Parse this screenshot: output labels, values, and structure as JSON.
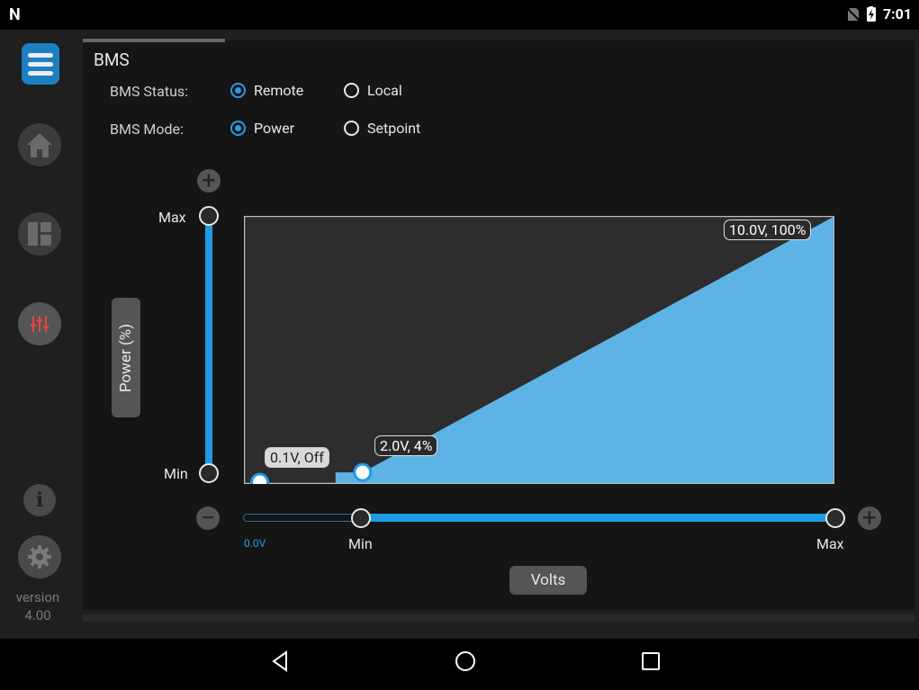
{
  "status": {
    "time": "7:01"
  },
  "sidebar": {
    "version_label": "version",
    "version_number": "4.00"
  },
  "panel": {
    "title": "BMS",
    "status_label": "BMS Status:",
    "status_options": [
      "Remote",
      "Local"
    ],
    "status_selected": "Remote",
    "mode_label": "BMS Mode:",
    "mode_options": [
      "Power",
      "Setpoint"
    ],
    "mode_selected": "Power"
  },
  "graph": {
    "y_axis_label": "Power (%)",
    "x_axis_label": "Volts",
    "y_max_label": "Max",
    "y_min_label": "Min",
    "x_min_label": "Min",
    "x_max_label": "Max",
    "x_start_value": "0.0V",
    "points": [
      {
        "label": "0.1V, Off",
        "volts": 0.1,
        "power": 0
      },
      {
        "label": "2.0V, 4%",
        "volts": 2.0,
        "power": 4
      },
      {
        "label": "10.0V, 100%",
        "volts": 10.0,
        "power": 100
      }
    ],
    "colors": {
      "fill": "#5db3e6",
      "accent": "#1e9be4",
      "plot_bg": "#2d2d2d"
    }
  }
}
